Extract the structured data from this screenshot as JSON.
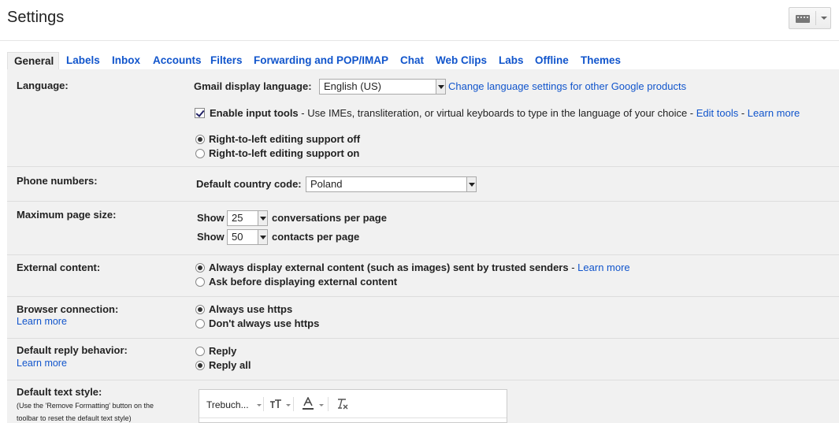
{
  "header": {
    "title": "Settings",
    "keyboard_icon": "keyboard-icon"
  },
  "tabs": [
    {
      "label": "General",
      "active": true
    },
    {
      "label": "Labels"
    },
    {
      "label": "Inbox"
    },
    {
      "label": "Accounts"
    },
    {
      "label": "Filters"
    },
    {
      "label": "Forwarding and POP/IMAP"
    },
    {
      "label": "Chat"
    },
    {
      "label": "Web Clips"
    },
    {
      "label": "Labs"
    },
    {
      "label": "Offline"
    },
    {
      "label": "Themes"
    }
  ],
  "language": {
    "label": "Language:",
    "display_language_label": "Gmail display language:",
    "display_language_value": "English (US)",
    "change_link": "Change language settings for other Google products",
    "input_tools_label": "Enable input tools",
    "input_tools_desc": " - Use IMEs, transliteration, or virtual keyboards to type in the language of your choice - ",
    "edit_tools": "Edit tools",
    "dash": " - ",
    "learn_more": "Learn more",
    "rtl_off": "Right-to-left editing support off",
    "rtl_on": "Right-to-left editing support on"
  },
  "phone": {
    "label": "Phone numbers:",
    "country_code_label": "Default country code:",
    "country_code_value": "Poland"
  },
  "page_size": {
    "label": "Maximum page size:",
    "show": "Show",
    "conversations_value": "25",
    "conversations_label": "conversations per page",
    "contacts_value": "50",
    "contacts_label": "contacts per page"
  },
  "external": {
    "label": "External content:",
    "always": "Always display external content (such as images) sent by trusted senders",
    "dash": " - ",
    "learn_more": "Learn more",
    "ask": "Ask before displaying external content"
  },
  "browser": {
    "label": "Browser connection:",
    "learn_more": "Learn more",
    "always_https": "Always use https",
    "dont_https": "Don't always use https"
  },
  "reply": {
    "label": "Default reply behavior:",
    "learn_more": "Learn more",
    "reply": "Reply",
    "reply_all": "Reply all"
  },
  "text_style": {
    "label": "Default text style:",
    "note": "(Use the 'Remove Formatting' button on the toolbar to reset the default text style)",
    "font": "Trebuch...",
    "size_icon": "font-size-icon",
    "color_icon": "text-color-icon",
    "remove_icon": "remove-formatting-icon"
  }
}
